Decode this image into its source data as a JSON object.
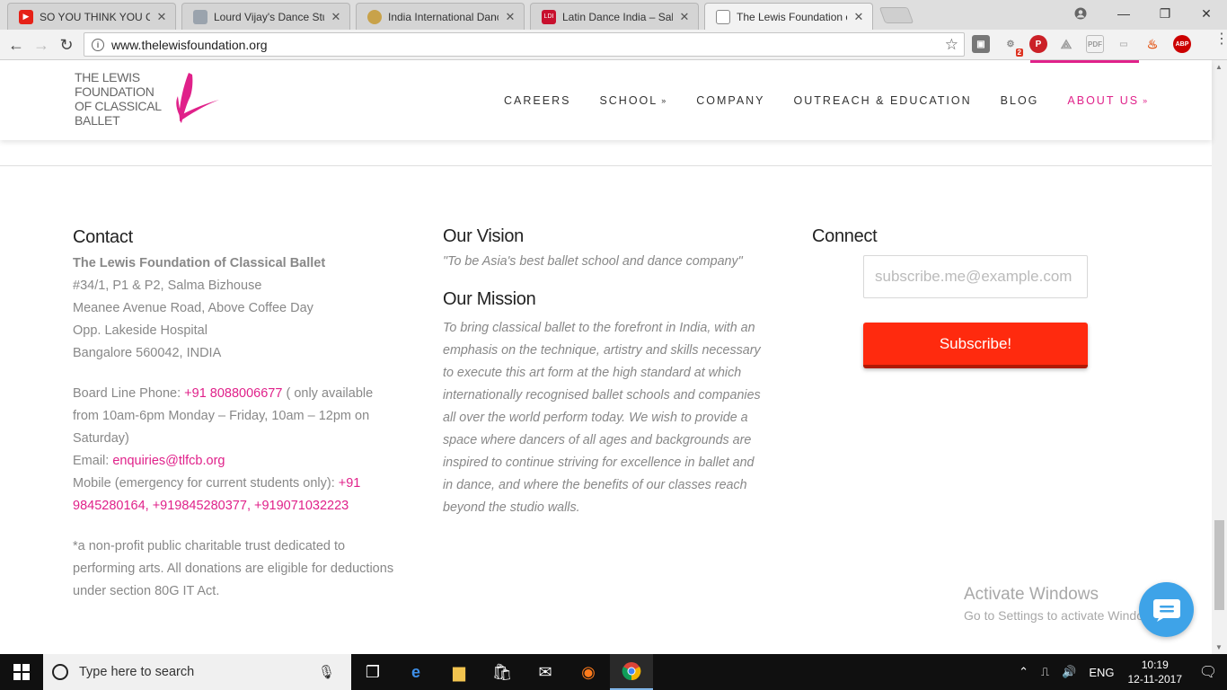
{
  "browser": {
    "tabs": [
      {
        "title": "SO YOU THINK YOU CAN",
        "icon": "youtube-icon",
        "active": false
      },
      {
        "title": "Lourd Vijay's Dance Stud",
        "icon": "page-icon",
        "active": false
      },
      {
        "title": "India International Dance",
        "icon": "site-icon",
        "active": false
      },
      {
        "title": "Latin Dance India – Salsa",
        "icon": "ldi-icon",
        "active": false
      },
      {
        "title": "The Lewis Foundation of",
        "icon": "document-icon",
        "active": true
      }
    ],
    "url": "www.thelewisfoundation.org",
    "extension_badge": "2",
    "abp_label": "ABP",
    "pdf_label": "PDF"
  },
  "site": {
    "logo_lines": [
      "THE LEWIS",
      "FOUNDATION",
      "OF CLASSICAL",
      "BALLET"
    ],
    "nav": [
      {
        "label": "CAREERS",
        "has_dropdown": false,
        "active": false
      },
      {
        "label": "SCHOOL",
        "has_dropdown": true,
        "active": false
      },
      {
        "label": "COMPANY",
        "has_dropdown": false,
        "active": false
      },
      {
        "label": "OUTREACH & EDUCATION",
        "has_dropdown": false,
        "active": false
      },
      {
        "label": "BLOG",
        "has_dropdown": false,
        "active": false
      },
      {
        "label": "ABOUT US",
        "has_dropdown": true,
        "active": true
      }
    ],
    "accent_color": "#e0218a"
  },
  "contact": {
    "heading": "Contact",
    "org_name": "The Lewis Foundation of Classical Ballet",
    "address": [
      "#34/1, P1 & P2, Salma Bizhouse",
      "Meanee Avenue Road, Above Coffee Day",
      "Opp. Lakeside Hospital",
      "Bangalore 560042, INDIA"
    ],
    "board_label": "Board Line Phone: ",
    "board_phone": "+91 8088006677",
    "board_hours": "  ( only available from 10am-6pm Monday – Friday, 10am – 12pm on Saturday)",
    "email_label": "Email: ",
    "email": "enquiries@tlfcb.org",
    "mobile_label": "Mobile (emergency for current students only): ",
    "mobile_numbers": "+91 9845280164, +919845280377, +919071032223",
    "footnote": "*a non-profit public charitable trust dedicated to performing arts. All donations are eligible for deductions under section 80G IT Act."
  },
  "vision": {
    "heading": "Our Vision",
    "text": "\"To be Asia's best ballet school and dance company\"",
    "mission_heading": "Our Mission",
    "mission_text": "To bring classical ballet to the forefront in India, with an emphasis on the technique, artistry and skills necessary to execute this art form at the high standard at which internationally recognised ballet schools and companies all over the world perform today. We wish to provide a space where dancers of all ages and backgrounds are inspired to continue striving for excellence in ballet and in dance, and where the benefits of our classes reach beyond the studio walls."
  },
  "connect": {
    "heading": "Connect",
    "placeholder": "subscribe.me@example.com",
    "button": "Subscribe!",
    "button_color": "#ff2a0e"
  },
  "watermark": {
    "line1": "Activate Windows",
    "line2": "Go to Settings to activate Windows."
  },
  "taskbar": {
    "search_placeholder": "Type here to search",
    "language": "ENG",
    "time": "10:19",
    "date": "12-11-2017"
  }
}
